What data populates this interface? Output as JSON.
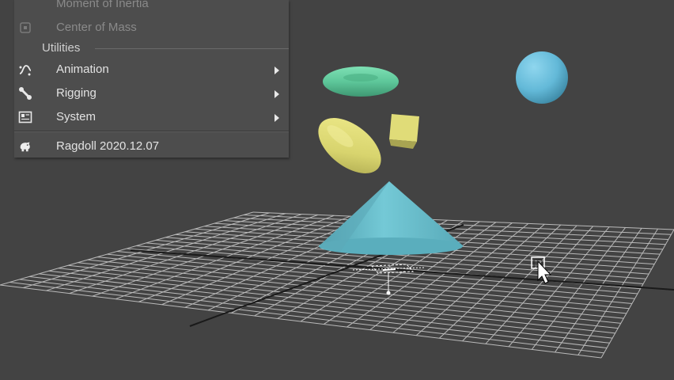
{
  "menu": {
    "items_top": [
      {
        "label": "Moment of Inertia",
        "icon": "moment-of-inertia-icon",
        "disabled": true
      },
      {
        "label": "Center of Mass",
        "icon": "center-of-mass-icon",
        "disabled": true
      }
    ],
    "section_label": "Utilities",
    "items": [
      {
        "label": "Animation",
        "icon": "animation-curve-icon",
        "submenu": true
      },
      {
        "label": "Rigging",
        "icon": "bone-icon",
        "submenu": true
      },
      {
        "label": "System",
        "icon": "system-panel-icon",
        "submenu": true
      }
    ],
    "version_item": {
      "label": "Ragdoll 2020.12.07",
      "icon": "ragdoll-logo-icon"
    }
  },
  "viewport": {
    "background": "#434343",
    "objects": [
      {
        "name": "green-torus",
        "color": "#5ec79a"
      },
      {
        "name": "blue-sphere",
        "color": "#6cbfdc"
      },
      {
        "name": "yellow-capsule",
        "color": "#d8d46e"
      },
      {
        "name": "yellow-cube",
        "color": "#e0dc78"
      },
      {
        "name": "cyan-cone",
        "color": "#67bccb"
      }
    ]
  }
}
